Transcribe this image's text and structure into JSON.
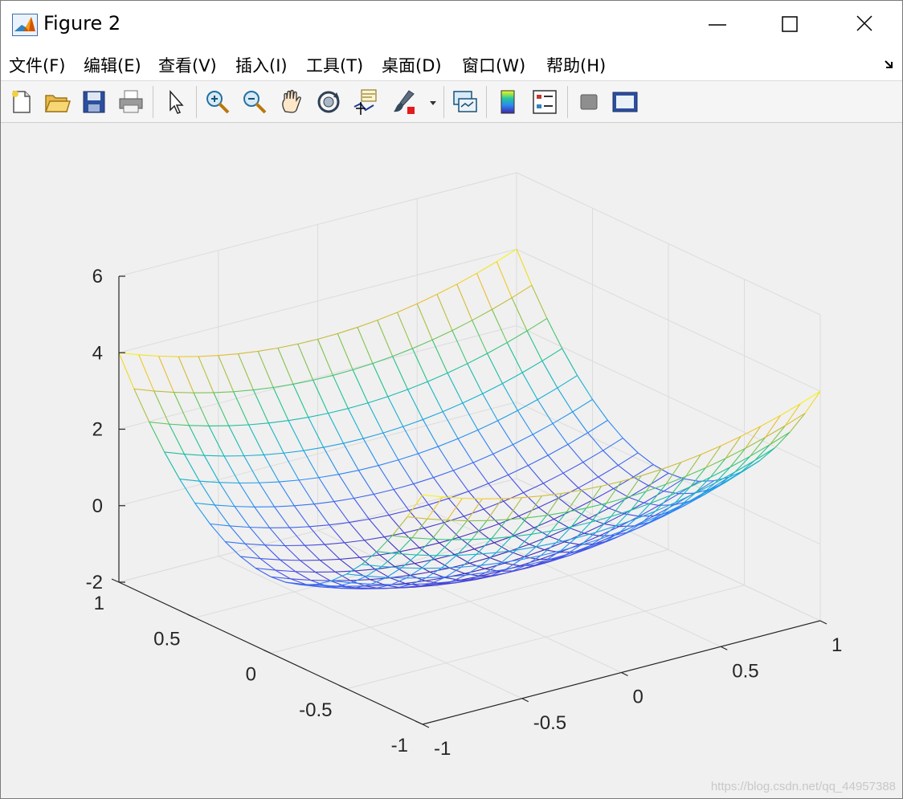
{
  "window": {
    "title": "Figure 2"
  },
  "menu": {
    "items": [
      {
        "label": "文件(F)",
        "name": "menu-file"
      },
      {
        "label": "编辑(E)",
        "name": "menu-edit"
      },
      {
        "label": "查看(V)",
        "name": "menu-view"
      },
      {
        "label": "插入(I)",
        "name": "menu-insert"
      },
      {
        "label": "工具(T)",
        "name": "menu-tools"
      },
      {
        "label": "桌面(D)",
        "name": "menu-desktop"
      },
      {
        "label": "窗口(W)",
        "name": "menu-window"
      },
      {
        "label": "帮助(H)",
        "name": "menu-help"
      }
    ]
  },
  "toolbar": {
    "icons": [
      "new-figure-icon",
      "open-file-icon",
      "save-figure-icon",
      "print-figure-icon",
      "edit-plot-icon",
      "zoom-in-icon",
      "zoom-out-icon",
      "pan-icon",
      "rotate-3d-icon",
      "data-cursor-icon",
      "brush-icon",
      "brush-dropdown-icon",
      "link-plot-icon",
      "insert-colorbar-icon",
      "insert-legend-icon",
      "hide-plot-tools-icon",
      "show-plot-tools-icon"
    ]
  },
  "chart_data": {
    "type": "surface-mesh",
    "function": "z = x^2 + 4*y^2 - 1 (mesh on x,y in [-1,1])",
    "x_range": [
      -1,
      1
    ],
    "y_range": [
      -1,
      1
    ],
    "zlim": [
      -2,
      6
    ],
    "grid": true,
    "colormap": "parula",
    "x_ticks": [
      "-1",
      "-0.5",
      "0",
      "0.5",
      "1"
    ],
    "y_ticks": [
      "-1",
      "-0.5",
      "0",
      "0.5",
      "1"
    ],
    "z_ticks": [
      "-2",
      "0",
      "2",
      "4",
      "6"
    ],
    "z_min": -1,
    "z_max": 4
  },
  "watermark": "https://blog.csdn.net/qq_44957388"
}
